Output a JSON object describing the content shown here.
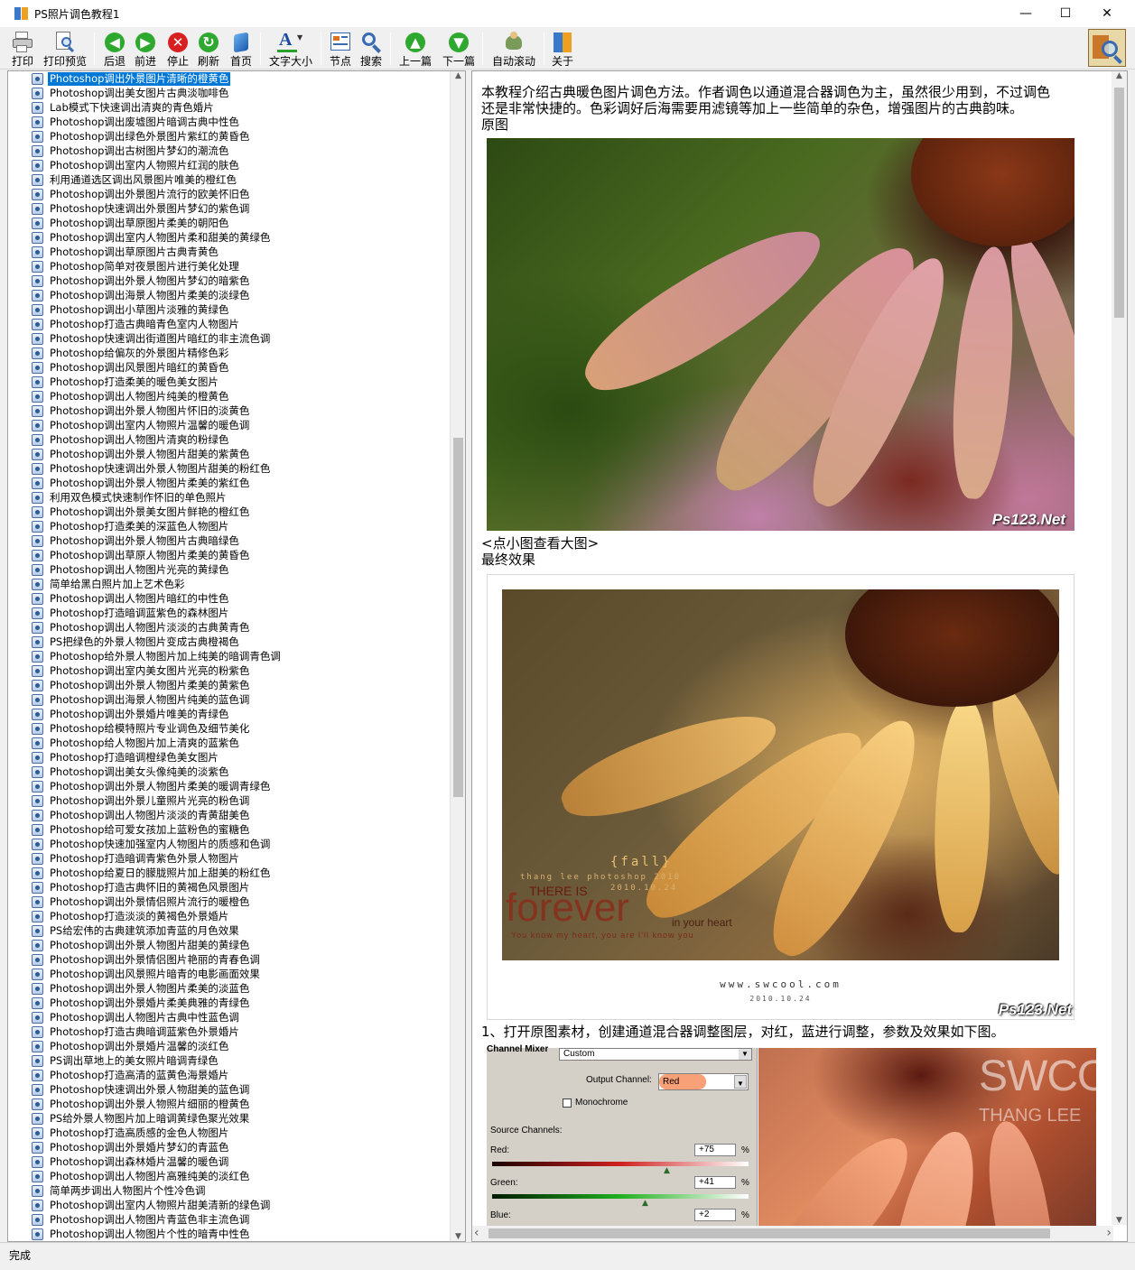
{
  "window": {
    "title": "PS照片调色教程1",
    "minimize": "—",
    "maximize": "☐",
    "close": "✕"
  },
  "toolbar": {
    "buttons": [
      {
        "label": "打印",
        "icon": "printer-icon"
      },
      {
        "label": "打印预览",
        "icon": "print-preview-icon"
      },
      {
        "label": "后退",
        "icon": "back-arrow-icon"
      },
      {
        "label": "前进",
        "icon": "forward-arrow-icon"
      },
      {
        "label": "停止",
        "icon": "stop-icon"
      },
      {
        "label": "刷新",
        "icon": "refresh-icon"
      },
      {
        "label": "首页",
        "icon": "home-icon"
      },
      {
        "label": "文字大小",
        "icon": "text-size-icon"
      },
      {
        "label": "节点",
        "icon": "node-icon"
      },
      {
        "label": "搜索",
        "icon": "search-icon"
      },
      {
        "label": "上一篇",
        "icon": "up-arrow-icon"
      },
      {
        "label": "下一篇",
        "icon": "down-arrow-icon"
      },
      {
        "label": "自动滚动",
        "icon": "auto-scroll-icon"
      },
      {
        "label": "关于",
        "icon": "about-icon"
      }
    ]
  },
  "tree": {
    "selected_index": 0,
    "items": [
      "Photoshop调出外景图片清晰的橙黄色",
      "Photoshop调出美女图片古典淡咖啡色",
      "Lab模式下快速调出清爽的青色婚片",
      "Photoshop调出废墟图片暗调古典中性色",
      "Photoshop调出绿色外景图片紫红的黄昏色",
      "Photoshop调出古树图片梦幻的潮流色",
      "Photoshop调出室内人物照片红润的肤色",
      "利用通道选区调出风景图片唯美的橙红色",
      "Photoshop调出外景图片流行的欧美怀旧色",
      "Photoshop快速调出外景图片梦幻的紫色调",
      "Photoshop调出草原图片柔美的朝阳色",
      "Photoshop调出室内人物图片柔和甜美的黄绿色",
      "Photoshop调出草原图片古典青黄色",
      "Photoshop简单对夜景图片进行美化处理",
      "Photoshop调出外景人物图片梦幻的暗紫色",
      "Photoshop调出海景人物图片柔美的淡绿色",
      "Photoshop调出小草图片淡雅的黄绿色",
      "Photoshop打造古典暗青色室内人物图片",
      "Photoshop快速调出街道图片暗红的非主流色调",
      "Photoshop给偏灰的外景图片精修色彩",
      "Photoshop调出风景图片暗红的黄昏色",
      "Photoshop打造柔美的暖色美女图片",
      "Photoshop调出人物图片纯美的橙黄色",
      "Photoshop调出外景人物图片怀旧的淡黄色",
      "Photoshop调出室内人物照片温馨的暖色调",
      "Photoshop调出人物图片清爽的粉绿色",
      "Photoshop调出外景人物图片甜美的紫黄色",
      "Photoshop快速调出外景人物图片甜美的粉红色",
      "Photoshop调出外景人物图片柔美的紫红色",
      "利用双色模式快速制作怀旧的单色照片",
      "Photoshop调出外景美女图片鲜艳的橙红色",
      "Photoshop打造柔美的深蓝色人物图片",
      "Photoshop调出外景人物图片古典暗绿色",
      "Photoshop调出草原人物图片柔美的黄昏色",
      "Photoshop调出人物图片光亮的黄绿色",
      "简单给黑白照片加上艺术色彩",
      "Photoshop调出人物图片暗红的中性色",
      "Photoshop打造暗调蓝紫色的森林图片",
      "Photoshop调出人物图片淡淡的古典黄青色",
      "PS把绿色的外景人物图片变成古典橙褐色",
      "Photoshop给外景人物图片加上纯美的暗调青色调",
      "Photoshop调出室内美女图片光亮的粉紫色",
      "Photoshop调出外景人物图片柔美的黄紫色",
      "Photoshop调出海景人物图片纯美的蓝色调",
      "Photoshop调出外景婚片唯美的青绿色",
      "Photoshop给模特照片专业调色及细节美化",
      "Photoshop给人物图片加上清爽的蓝紫色",
      "Photoshop打造暗调橙绿色美女图片",
      "Photoshop调出美女头像纯美的淡紫色",
      "Photoshop调出外景人物图片柔美的暖调青绿色",
      "Photoshop调出外景儿童照片光亮的粉色调",
      "Photoshop调出人物图片淡淡的青黄甜美色",
      "Photoshop给可爱女孩加上蓝粉色的蜜糖色",
      "Photoshop快速加强室内人物图片的质感和色调",
      "Photoshop打造暗调青紫色外景人物图片",
      "Photoshop给夏日的朦胧照片加上甜美的粉红色",
      "Photoshop打造古典怀旧的黄褐色风景图片",
      "Photoshop调出外景情侣照片流行的暖橙色",
      "Photoshop打造淡淡的黄褐色外景婚片",
      "PS给宏伟的古典建筑添加青蓝的月色效果",
      "Photoshop调出外景人物图片甜美的黄绿色",
      "Photoshop调出外景情侣图片艳丽的青春色调",
      "Photoshop调出风景照片暗青的电影画面效果",
      "Photoshop调出外景人物图片柔美的淡蓝色",
      "Photoshop调出外景婚片柔美典雅的青绿色",
      "Photoshop调出人物图片古典中性蓝色调",
      "Photoshop打造古典暗调蓝紫色外景婚片",
      "Photoshop调出外景婚片温馨的淡红色",
      "PS调出草地上的美女照片暗调青绿色",
      "Photoshop打造高清的蓝黄色海景婚片",
      "Photoshop快速调出外景人物甜美的蓝色调",
      "Photoshop调出外景人物照片细丽的橙黄色",
      "PS给外景人物图片加上暗调黄绿色聚光效果",
      "Photoshop打造高质感的金色人物图片",
      "Photoshop调出外景婚片梦幻的青蓝色",
      "Photoshop调出森林婚片温馨的暖色调",
      "Photoshop调出人物图片高雅纯美的淡红色",
      "简单两步调出人物图片个性冷色调",
      "Photoshop调出室内人物照片甜美清新的绿色调",
      "Photoshop调出人物图片青蓝色非主流色调",
      "Photoshop调出人物图片个性的暗青中性色"
    ]
  },
  "content": {
    "intro_line1": "本教程介绍古典暖色图片调色方法。作者调色以通道混合器调色为主，虽然很少用到，不过调色",
    "intro_line2": "还是非常快捷的。色彩调好后海需要用滤镜等加上一些简单的杂色，增强图片的古典韵味。",
    "original_label": "原图",
    "click_hint": "<点小图查看大图>",
    "final_label": "最终效果",
    "watermark": "Ps123.Net",
    "final_image": {
      "fall": "{fall}",
      "author": "thang lee photoshop 2010",
      "date": "2010.10.24",
      "there_is": "THERE IS",
      "forever": "forever",
      "in_your_heart": "in your heart",
      "small_line": "You know my heart, you are I'll know you",
      "site": "www.swcool.com",
      "site_date": "2010.10.24"
    },
    "step1": "1、打开原图素材，创建通道混合器调整图层，对红，蓝进行调整，参数及效果如下图。",
    "mixer": {
      "header": "Channel Mixer",
      "preset": "Custom",
      "output_label": "Output Channel:",
      "output_value": "Red",
      "monochrome": "Monochrome",
      "source_label": "Source Channels:",
      "red_label": "Red:",
      "red_value": "+75",
      "green_label": "Green:",
      "green_value": "+41",
      "blue_label": "Blue:",
      "blue_value": "+2",
      "pct": "%"
    },
    "photo_text1": "SWCOO",
    "photo_text2": "THANG LEE"
  },
  "status": {
    "text": "完成"
  }
}
